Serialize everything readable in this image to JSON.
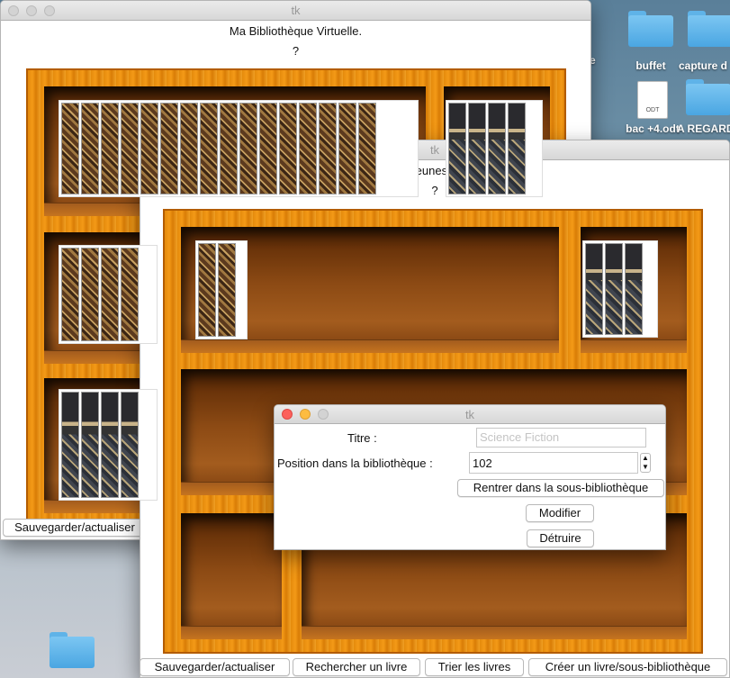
{
  "desktop": {
    "icons": [
      {
        "label": "buffet"
      },
      {
        "label": "capture d"
      },
      {
        "label": "bac +4.odt",
        "doc_type": "ODT"
      },
      {
        "label": "A REGARD"
      }
    ],
    "fragment_e": "e"
  },
  "main_window": {
    "title": "tk",
    "heading": "Ma Bibliothèque Virtuelle.",
    "subheading": "?",
    "save_button": "Sauvegarder/actualiser"
  },
  "jeunesse_window": {
    "title": "tk",
    "heading": "Jeunesse",
    "subheading": "?",
    "buttons": {
      "save": "Sauvegarder/actualiser",
      "search": "Rechercher un livre",
      "sort": "Trier les livres",
      "create": "Créer un livre/sous-bibliothèque"
    }
  },
  "dialog": {
    "title": "tk",
    "title_label": "Titre :",
    "title_placeholder": "Science Fiction",
    "position_label": "Position dans la bibliothèque :",
    "position_value": "102",
    "enter_button": "Rentrer dans la sous-bibliothèque",
    "modify_button": "Modifier",
    "destroy_button": "Détruire"
  },
  "colors": {
    "wood": "#f39a17",
    "wood_dark": "#b35c00",
    "close_red": "#fc605c",
    "minimize_yellow": "#fdbc40"
  }
}
